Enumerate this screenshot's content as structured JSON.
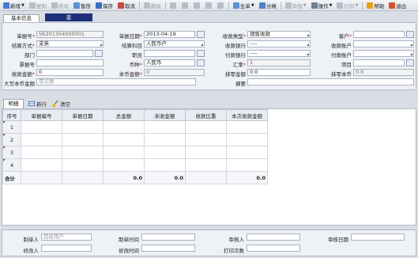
{
  "toolbar": {
    "items": [
      {
        "label": "新增",
        "caret": true,
        "disabled": false,
        "icon": "new-icon",
        "color": "#4a7bd0"
      },
      {
        "label": "复制",
        "caret": false,
        "disabled": true,
        "icon": "copy-icon",
        "color": "#b8bec7"
      },
      {
        "label": "修改",
        "caret": false,
        "disabled": true,
        "icon": "edit-icon",
        "color": "#b8bec7"
      },
      {
        "label": "暂存",
        "caret": false,
        "disabled": false,
        "icon": "draft-icon",
        "color": "#5a8fd6"
      },
      {
        "label": "保存",
        "caret": false,
        "disabled": false,
        "icon": "save-icon",
        "color": "#3d6fc0"
      },
      {
        "label": "取消",
        "caret": false,
        "disabled": false,
        "icon": "cancel-icon",
        "color": "#c94b3c"
      },
      {
        "label": "删除",
        "caret": false,
        "disabled": true,
        "icon": "delete-icon",
        "color": "#b8bec7"
      },
      {
        "label": "",
        "caret": false,
        "disabled": true,
        "icon": "filter-icon",
        "color": "#b8bec7"
      },
      {
        "label": "",
        "caret": false,
        "disabled": true,
        "icon": "first-icon",
        "color": "#b8bec7"
      },
      {
        "label": "",
        "caret": false,
        "disabled": true,
        "icon": "prev-icon",
        "color": "#b8bec7"
      },
      {
        "label": "",
        "caret": false,
        "disabled": true,
        "icon": "next-icon",
        "color": "#b8bec7"
      },
      {
        "label": "",
        "caret": false,
        "disabled": true,
        "icon": "last-icon",
        "color": "#b8bec7"
      },
      {
        "label": "生单",
        "caret": true,
        "disabled": false,
        "icon": "generate-icon",
        "color": "#5d8fd3"
      },
      {
        "label": "分摊",
        "caret": false,
        "disabled": false,
        "icon": "allocate-icon",
        "color": "#4f7fc8"
      },
      {
        "label": "审核",
        "caret": true,
        "disabled": true,
        "icon": "audit-icon",
        "color": "#b8bec7"
      },
      {
        "label": "操作",
        "caret": true,
        "disabled": false,
        "icon": "gear-icon",
        "color": "#6f7f95"
      },
      {
        "label": "打印",
        "caret": true,
        "disabled": true,
        "icon": "print-icon",
        "color": "#b8bec7"
      },
      {
        "label": "帮助",
        "caret": false,
        "disabled": false,
        "icon": "help-icon",
        "color": "#e2a21a"
      },
      {
        "label": "退出",
        "caret": false,
        "disabled": false,
        "icon": "exit-icon",
        "color": "#d0552f"
      }
    ]
  },
  "tabs": {
    "basic": "基本信息",
    "dark": "蓝"
  },
  "form": {
    "bill_no_label": "单据号",
    "bill_no": "SK201304000001",
    "bill_date_label": "单据日期",
    "bill_date": "2013-04-19",
    "receipt_type_label": "收款类型",
    "receipt_type": "销售收款",
    "customer_label": "客户",
    "customer": "",
    "settle_label": "结算方式",
    "settle": "支票",
    "settle_account_label": "结算科目",
    "settle_account": "人民币户",
    "pay_bank_label": "收款银行",
    "pay_bank": "----",
    "recv_account_label": "收款账户",
    "recv_account": "",
    "dept_label": "部门",
    "dept": "",
    "staff_label": "职员",
    "staff": "",
    "payer_bank_label": "付款银行",
    "payer_bank": "----",
    "payer_account_label": "付款账户",
    "payer_account": "",
    "ticket_label": "票据号",
    "ticket": "",
    "currency_label": "币种",
    "currency": "人民币",
    "rate_label": "汇率",
    "rate": "1",
    "project_label": "项目",
    "project": "",
    "amount_label": "收款金额",
    "amount": "0",
    "local_amount_label": "本币金额",
    "local_amount": "0",
    "rounding_label": "抹零金额",
    "rounding": "0.0",
    "rounding_local_label": "抹零本币",
    "rounding_local": "0.0",
    "upper_label": "大写本币金额",
    "upper_placeholder": "零元整",
    "memo_label": "摘要",
    "memo": ""
  },
  "detail": {
    "tab": "明细",
    "add_row": "新行",
    "clear": "清空",
    "columns": [
      "序号",
      "单据编号",
      "单据日期",
      "总金额",
      "未收金额",
      "收款比重",
      "本次收款金额"
    ],
    "rows": [
      {
        "no": "1",
        "bill": "",
        "date": "",
        "total": "",
        "unpaid": "",
        "ratio": "",
        "current": ""
      },
      {
        "no": "2",
        "bill": "",
        "date": "",
        "total": "",
        "unpaid": "",
        "ratio": "",
        "current": ""
      },
      {
        "no": "3",
        "bill": "",
        "date": "",
        "total": "",
        "unpaid": "",
        "ratio": "",
        "current": ""
      },
      {
        "no": "4",
        "bill": "",
        "date": "",
        "total": "",
        "unpaid": "",
        "ratio": "",
        "current": ""
      }
    ],
    "sum": {
      "label": "合计",
      "total": "0.0",
      "unpaid": "0.0",
      "current": "0.0"
    }
  },
  "footer": {
    "maker_label": "制单人",
    "maker": "超级用户",
    "make_time_label": "制单时间",
    "make_time": "",
    "auditor_label": "审核人",
    "auditor": "",
    "audit_date_label": "审核日期",
    "audit_date": "",
    "modifier_label": "修改人",
    "modifier": "",
    "modify_time_label": "修改时间",
    "modify_time": "",
    "print_count_label": "打印次数",
    "print_count": ""
  }
}
